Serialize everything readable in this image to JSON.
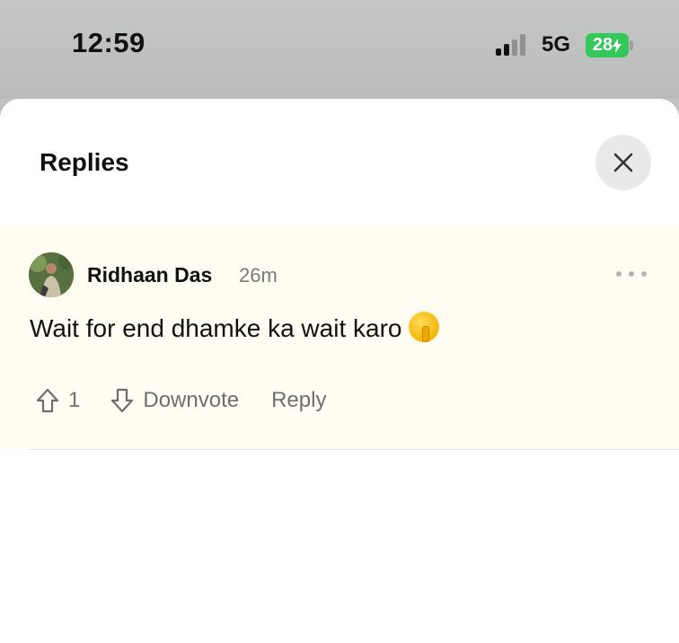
{
  "status_bar": {
    "time": "12:59",
    "network": "5G",
    "battery": "28"
  },
  "sheet": {
    "title": "Replies"
  },
  "comment": {
    "author": "Ridhaan Das",
    "timestamp": "26m",
    "text": "Wait for end dhamke ka wait karo",
    "emoji": "shushing-face",
    "upvotes": "1",
    "downvote_label": "Downvote",
    "reply_label": "Reply"
  },
  "colors": {
    "comment_background": "#fffdf2",
    "battery": "#34c759",
    "muted_text": "#6e6e6e"
  }
}
